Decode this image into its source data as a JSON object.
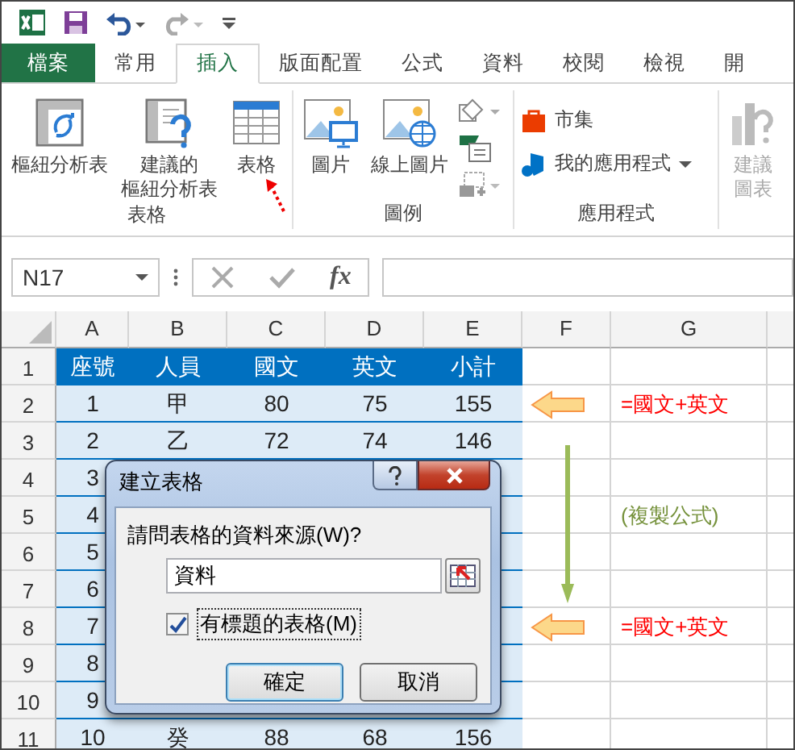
{
  "tabs": [
    {
      "label": "檔案",
      "kind": "file",
      "selected": false
    },
    {
      "label": "常用",
      "kind": "tab",
      "selected": false
    },
    {
      "label": "插入",
      "kind": "tab",
      "selected": true
    },
    {
      "label": "版面配置",
      "kind": "tab",
      "selected": false
    },
    {
      "label": "公式",
      "kind": "tab",
      "selected": false
    },
    {
      "label": "資料",
      "kind": "tab",
      "selected": false
    },
    {
      "label": "校閱",
      "kind": "tab",
      "selected": false
    },
    {
      "label": "檢視",
      "kind": "tab",
      "selected": false
    },
    {
      "label": "開",
      "kind": "tab",
      "selected": false
    }
  ],
  "ribbon_groups": [
    {
      "label": "表格",
      "buttons": [
        {
          "lines": [
            "樞紐分析表"
          ],
          "kind": "pivot",
          "disabled": false
        },
        {
          "lines": [
            "建議的",
            "樞紐分析表"
          ],
          "kind": "suggest-pivot",
          "disabled": false
        },
        {
          "lines": [
            "表格"
          ],
          "kind": "table",
          "disabled": false
        }
      ]
    },
    {
      "label": "圖例",
      "buttons": [
        {
          "lines": [
            "圖片"
          ],
          "kind": "picture",
          "disabled": false
        },
        {
          "lines": [
            "線上圖片"
          ],
          "kind": "online-picture",
          "disabled": false
        },
        {
          "kind": "small-icons"
        }
      ]
    },
    {
      "label": "應用程式",
      "buttons": [
        {
          "lines": [
            "市集"
          ],
          "kind": "store",
          "disabled": false
        },
        {
          "lines": [
            "我的應用程式"
          ],
          "kind": "my-apps",
          "disabled": false
        }
      ]
    },
    {
      "buttons": [
        {
          "lines": [
            "建議",
            "圖表"
          ],
          "kind": "suggest-chart",
          "disabled": true
        }
      ]
    }
  ],
  "name_box": "N17",
  "fx_label": "fx",
  "columns": [
    "A",
    "B",
    "C",
    "D",
    "E",
    "F",
    "G"
  ],
  "rows": [
    {
      "number": "1",
      "kind": "header",
      "cells": [
        "座號",
        "人員",
        "國文",
        "英文",
        "小計"
      ]
    },
    {
      "number": "2",
      "kind": "data",
      "cells": [
        "1",
        "甲",
        "80",
        "75",
        "155"
      ],
      "note": {
        "text": "=國文+英文",
        "color": "#ff0000"
      }
    },
    {
      "number": "3",
      "kind": "data",
      "cells": [
        "2",
        "乙",
        "72",
        "74",
        "146"
      ]
    },
    {
      "number": "4",
      "kind": "data",
      "cells": [
        "3"
      ]
    },
    {
      "number": "5",
      "kind": "data",
      "cells": [
        "4"
      ],
      "note": {
        "text": "(複製公式)",
        "color": "#76923c"
      }
    },
    {
      "number": "6",
      "kind": "data",
      "cells": [
        "5"
      ]
    },
    {
      "number": "7",
      "kind": "data",
      "cells": [
        "6"
      ]
    },
    {
      "number": "8",
      "kind": "data",
      "cells": [
        "7"
      ],
      "note": {
        "text": "=國文+英文",
        "color": "#ff0000"
      }
    },
    {
      "number": "9",
      "kind": "data",
      "cells": [
        "8"
      ]
    },
    {
      "number": "10",
      "kind": "data",
      "cells": [
        "9"
      ]
    },
    {
      "number": "11",
      "kind": "data",
      "cells": [
        "10",
        "癸",
        "88",
        "68",
        "156"
      ]
    }
  ],
  "dialog": {
    "title": "建立表格",
    "prompt": "請問表格的資料來源(W)?",
    "range_value": "資料",
    "header_checkbox": {
      "label": "有標題的表格(M)",
      "checked": true
    },
    "buttons": [
      {
        "label": "確定",
        "default": true
      },
      {
        "label": "取消",
        "default": false
      }
    ]
  }
}
